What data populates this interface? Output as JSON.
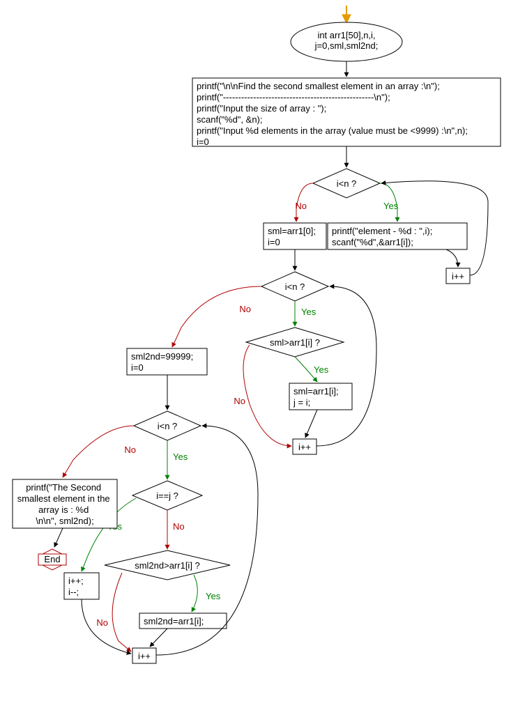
{
  "chart_data": {
    "type": "flowchart",
    "nodes": {
      "start": {
        "shape": "terminator",
        "label": "int arr1[50],n,i,\nj=0,sml,sml2nd;"
      },
      "init": {
        "shape": "process",
        "label": "printf(\"\\n\\nFind the second smallest element in an array :\\n\");\nprintf(\"--------------------------------------------------\\n\");\nprintf(\"Input the size of array : \");\nscanf(\"%d\", &n);\nprintf(\"Input %d elements in the array (value must be <9999) :\\n\",n);\ni=0"
      },
      "cond1": {
        "shape": "decision",
        "label": "i<n ?"
      },
      "read": {
        "shape": "process",
        "label": "printf(\"element - %d : \",i);\nscanf(\"%d\",&arr1[i]);"
      },
      "inc1": {
        "shape": "process",
        "label": "i++"
      },
      "sml0": {
        "shape": "process",
        "label": "sml=arr1[0];\ni=0"
      },
      "cond2": {
        "shape": "decision",
        "label": "i<n ?"
      },
      "cond3": {
        "shape": "decision",
        "label": "sml>arr1[i] ?"
      },
      "setsml": {
        "shape": "process",
        "label": "sml=arr1[i];\nj = i;"
      },
      "inc2": {
        "shape": "process",
        "label": "i++"
      },
      "sml2": {
        "shape": "process",
        "label": "sml2nd=99999;\ni=0"
      },
      "cond4": {
        "shape": "decision",
        "label": "i<n ?"
      },
      "cond5": {
        "shape": "decision",
        "label": "i==j ?"
      },
      "skip": {
        "shape": "process",
        "label": "i++;\ni--;"
      },
      "cond6": {
        "shape": "decision",
        "label": "sml2nd>arr1[i] ?"
      },
      "setsml2": {
        "shape": "process",
        "label": "sml2nd=arr1[i];"
      },
      "inc3": {
        "shape": "process",
        "label": "i++"
      },
      "print": {
        "shape": "process",
        "label": "printf(\"The Second smallest element in the array is :  %d \\n\\n\", sml2nd);"
      },
      "end": {
        "shape": "end",
        "label": "End"
      }
    },
    "edges": [
      {
        "from": "start",
        "to": "init"
      },
      {
        "from": "init",
        "to": "cond1"
      },
      {
        "from": "cond1",
        "to": "read",
        "label": "Yes"
      },
      {
        "from": "read",
        "to": "inc1"
      },
      {
        "from": "inc1",
        "to": "cond1"
      },
      {
        "from": "cond1",
        "to": "sml0",
        "label": "No"
      },
      {
        "from": "sml0",
        "to": "cond2"
      },
      {
        "from": "cond2",
        "to": "cond3",
        "label": "Yes"
      },
      {
        "from": "cond3",
        "to": "setsml",
        "label": "Yes"
      },
      {
        "from": "setsml",
        "to": "inc2"
      },
      {
        "from": "cond3",
        "to": "inc2",
        "label": "No"
      },
      {
        "from": "inc2",
        "to": "cond2"
      },
      {
        "from": "cond2",
        "to": "sml2",
        "label": "No"
      },
      {
        "from": "sml2",
        "to": "cond4"
      },
      {
        "from": "cond4",
        "to": "cond5",
        "label": "Yes"
      },
      {
        "from": "cond5",
        "to": "skip",
        "label": "Yes"
      },
      {
        "from": "cond5",
        "to": "cond6",
        "label": "No"
      },
      {
        "from": "cond6",
        "to": "setsml2",
        "label": "Yes"
      },
      {
        "from": "setsml2",
        "to": "inc3"
      },
      {
        "from": "cond6",
        "to": "inc3",
        "label": "No"
      },
      {
        "from": "skip",
        "to": "inc3"
      },
      {
        "from": "inc3",
        "to": "cond4"
      },
      {
        "from": "cond4",
        "to": "print",
        "label": "No"
      },
      {
        "from": "print",
        "to": "end"
      }
    ]
  },
  "labels": {
    "yes": "Yes",
    "no": "No",
    "end": "End"
  },
  "start_lines": [
    "int arr1[50],n,i,",
    "j=0,sml,sml2nd;"
  ],
  "init_lines": [
    "printf(\"\\n\\nFind the second smallest element in an array :\\n\");",
    "printf(\"--------------------------------------------------\\n\");",
    "printf(\"Input the size of array : \");",
    "scanf(\"%d\", &n);",
    "printf(\"Input %d elements in the array (value must be <9999) :\\n\",n);",
    "i=0"
  ],
  "cond1": "i<n ?",
  "read_lines": [
    "printf(\"element - %d : \",i);",
    "scanf(\"%d\",&arr1[i]);"
  ],
  "inc1": "i++",
  "sml0_lines": [
    "sml=arr1[0];",
    "i=0"
  ],
  "cond2": "i<n ?",
  "cond3": "sml>arr1[i] ?",
  "setsml_lines": [
    "sml=arr1[i];",
    "j = i;"
  ],
  "inc2": "i++",
  "sml2_lines": [
    "sml2nd=99999;",
    "i=0"
  ],
  "cond4": "i<n ?",
  "cond5": "i==j ?",
  "skip_lines": [
    "i++;",
    "i--;"
  ],
  "cond6": "sml2nd>arr1[i] ?",
  "setsml2": "sml2nd=arr1[i];",
  "inc3": "i++",
  "print_lines": [
    "printf(\"The Second",
    "smallest element in the",
    "array is :  %d",
    "\\n\\n\", sml2nd);"
  ]
}
